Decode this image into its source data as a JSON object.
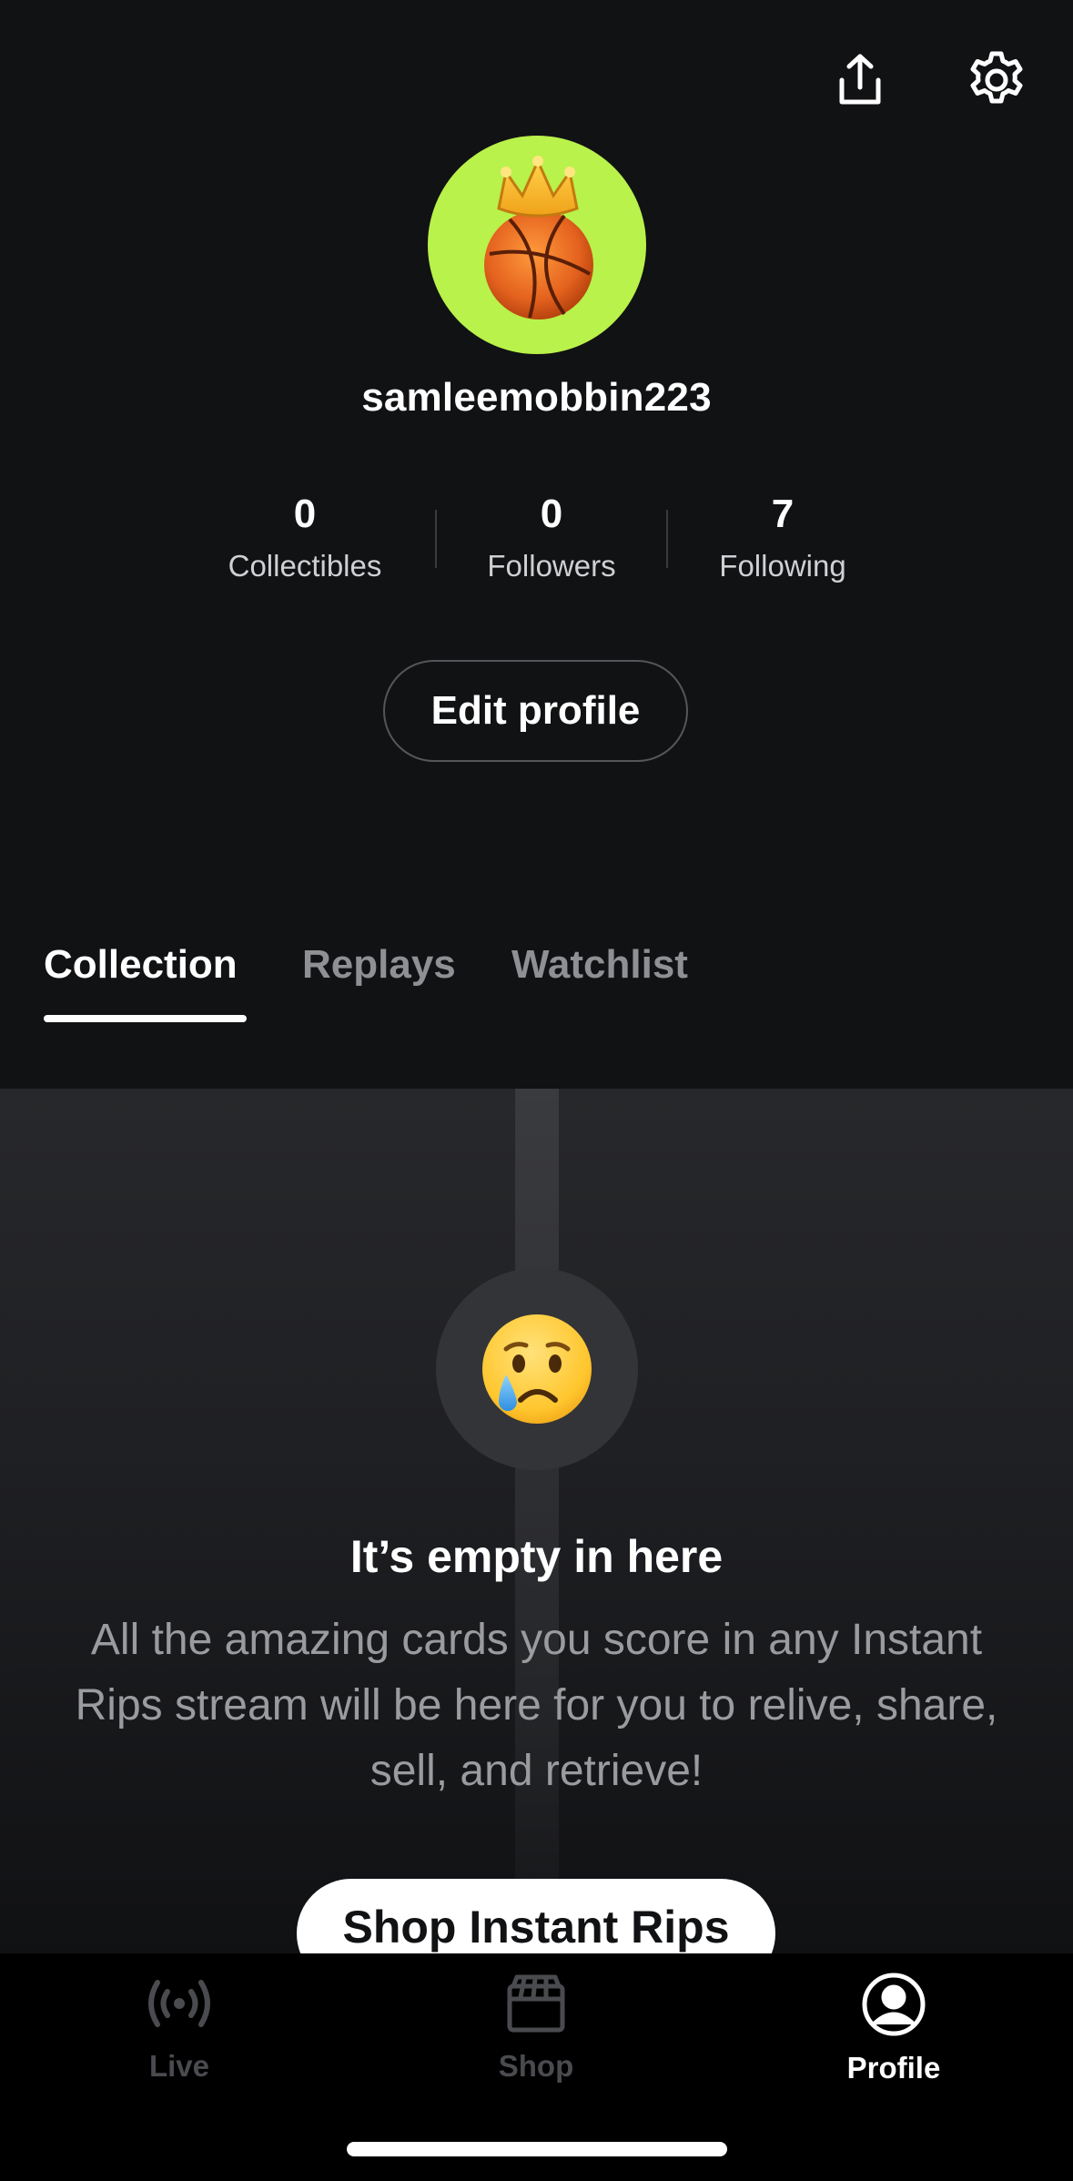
{
  "header": {
    "share_icon": "share-upload-icon",
    "settings_icon": "gear-icon"
  },
  "profile": {
    "avatar_icon": "crowned-basketball-avatar",
    "avatar_bg": "#b9f24a",
    "username": "samleemobbin223",
    "stats": [
      {
        "value": "0",
        "label": "Collectibles"
      },
      {
        "value": "0",
        "label": "Followers"
      },
      {
        "value": "7",
        "label": "Following"
      }
    ],
    "edit_label": "Edit profile"
  },
  "tabs": [
    {
      "label": "Collection",
      "active": true
    },
    {
      "label": "Replays",
      "active": false
    },
    {
      "label": "Watchlist",
      "active": false
    }
  ],
  "empty_state": {
    "emoji": "😢",
    "title": "It’s empty in here",
    "description": "All the amazing cards you score in any Instant Rips stream will be here for you to relive, share, sell, and retrieve!",
    "cta_label": "Shop Instant Rips"
  },
  "bottom_nav": [
    {
      "label": "Live",
      "icon": "live-broadcast-icon",
      "active": false
    },
    {
      "label": "Shop",
      "icon": "shop-box-icon",
      "active": false
    },
    {
      "label": "Profile",
      "icon": "profile-person-icon",
      "active": true
    }
  ]
}
